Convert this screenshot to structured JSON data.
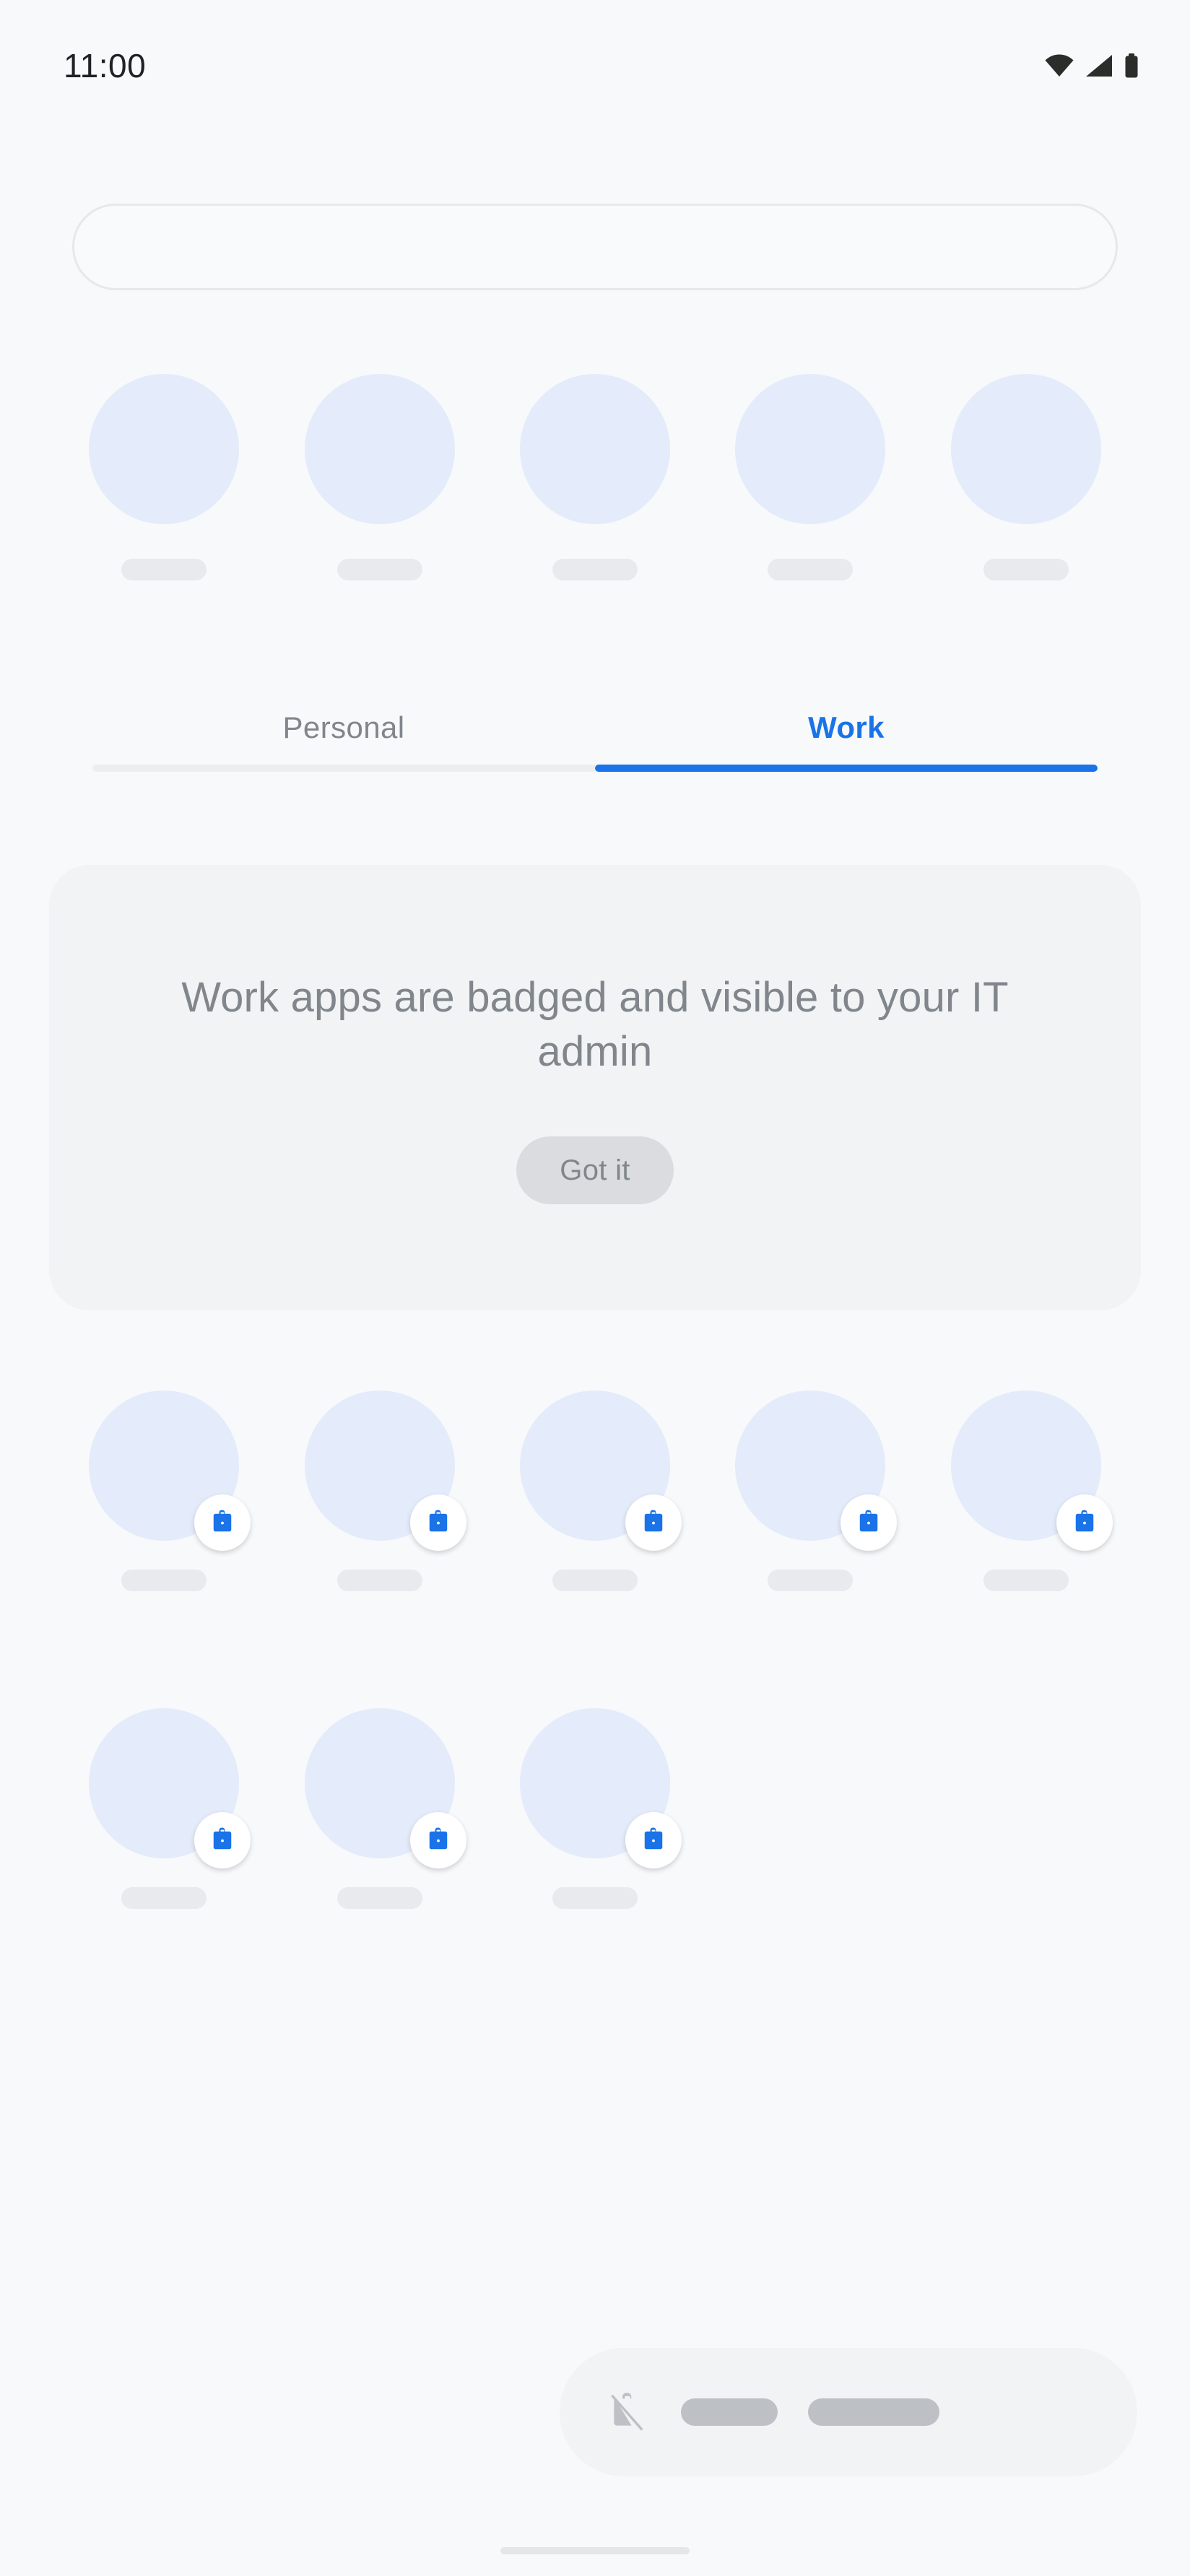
{
  "status_bar": {
    "time": "11:00",
    "icons": [
      {
        "name": "wifi-icon",
        "label": "Wi-Fi"
      },
      {
        "name": "cellular-signal-icon",
        "label": "Mobile signal"
      },
      {
        "name": "battery-icon",
        "label": "Battery"
      }
    ]
  },
  "search": {
    "value": "",
    "placeholder": ""
  },
  "suggested_apps": {
    "count": 5,
    "items": [
      {
        "label": "",
        "badged": false
      },
      {
        "label": "",
        "badged": false
      },
      {
        "label": "",
        "badged": false
      },
      {
        "label": "",
        "badged": false
      },
      {
        "label": "",
        "badged": false
      }
    ]
  },
  "tabs": {
    "items": [
      {
        "id": "personal",
        "label": "Personal",
        "active": false
      },
      {
        "id": "work",
        "label": "Work",
        "active": true
      }
    ],
    "active_index": 1,
    "active_color": "#1a73e8",
    "inactive_color": "#80868b"
  },
  "info_card": {
    "message": "Work apps are badged and visible to your IT admin",
    "button_label": "Got it",
    "background": "#f1f3f4",
    "text_color": "#80868b",
    "button_background": "#dadce0"
  },
  "work_apps": {
    "badge_icon": "work-briefcase-icon",
    "badge_color": "#1a73e8",
    "icon_placeholder_color": "#e4ebfa",
    "label_placeholder_color": "#e8eaed",
    "rows": [
      {
        "items": [
          {
            "label": "",
            "badged": true
          },
          {
            "label": "",
            "badged": true
          },
          {
            "label": "",
            "badged": true
          },
          {
            "label": "",
            "badged": true
          },
          {
            "label": "",
            "badged": true
          }
        ]
      },
      {
        "items": [
          {
            "label": "",
            "badged": true
          },
          {
            "label": "",
            "badged": true
          },
          {
            "label": "",
            "badged": true
          }
        ]
      }
    ]
  },
  "bottom_bar": {
    "icon": "work-off-briefcase-icon",
    "pills": [
      {
        "id": "pill-short",
        "width": 134
      },
      {
        "id": "pill-long",
        "width": 182
      }
    ],
    "background": "#f1f3f4",
    "pill_color": "#bdc1c6"
  },
  "gesture_handle": {
    "color": "#e4e6e8"
  },
  "theme": {
    "page_background": "#f7f9fb",
    "accent": "#1a73e8",
    "muted_text": "#80868b",
    "surface": "#f1f3f4"
  }
}
